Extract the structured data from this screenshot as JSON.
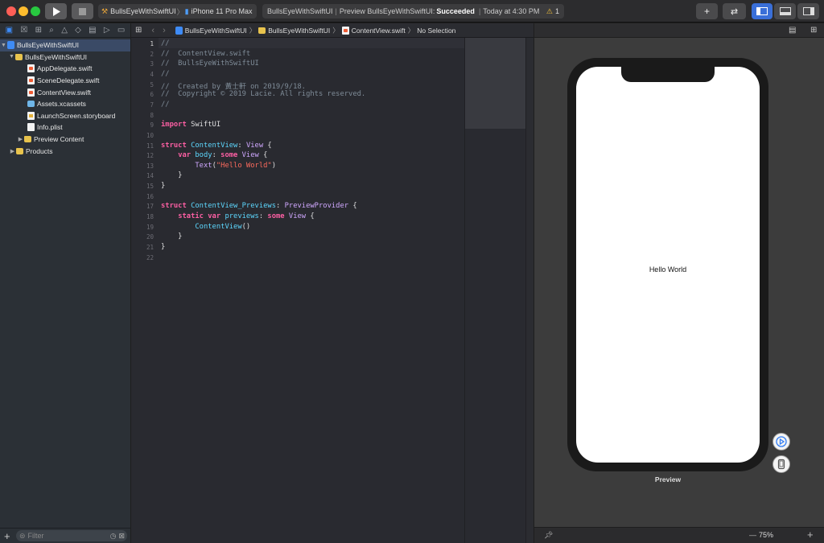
{
  "toolbar": {
    "run_icon": "play-icon",
    "stop_icon": "stop-icon",
    "scheme_target": "BullsEyeWithSwiftUI",
    "separator": "〉",
    "device": "iPhone 11 Pro Max",
    "status_project": "BullsEyeWithSwiftUI",
    "status_pipe": "|",
    "status_action": "Preview BullsEyeWithSwiftUI:",
    "status_result": "Succeeded",
    "status_pipe2": "|",
    "status_time": "Today at 4:30 PM",
    "warning_count": "1",
    "library_label": "+",
    "colors": {
      "close": "#ff5f57",
      "minimize": "#febc2e",
      "zoom": "#28c840",
      "toolbar_bg": "#2c2c2e",
      "accent": "#3d8bf7"
    }
  },
  "navigator": {
    "tabs": [
      "folder-icon",
      "source-control-icon",
      "symbol-icon",
      "find-icon",
      "issue-icon",
      "test-icon",
      "debug-icon",
      "breakpoint-icon",
      "report-icon"
    ],
    "tree": [
      {
        "label": "BullsEyeWithSwiftUI",
        "kind": "project",
        "expanded": true,
        "selected": true
      },
      {
        "label": "BullsEyeWithSwiftUI",
        "kind": "folder",
        "expanded": true
      },
      {
        "label": "AppDelegate.swift",
        "kind": "swift"
      },
      {
        "label": "SceneDelegate.swift",
        "kind": "swift"
      },
      {
        "label": "ContentView.swift",
        "kind": "swift"
      },
      {
        "label": "Assets.xcassets",
        "kind": "assets"
      },
      {
        "label": "LaunchScreen.storyboard",
        "kind": "storyboard"
      },
      {
        "label": "Info.plist",
        "kind": "plist"
      },
      {
        "label": "Preview Content",
        "kind": "folder",
        "expanded": false
      },
      {
        "label": "Products",
        "kind": "folder",
        "expanded": false
      }
    ],
    "add_label": "+",
    "filter_placeholder": "Filter"
  },
  "editor": {
    "breadcrumb": [
      "BullsEyeWithSwiftUI",
      "BullsEyeWithSwiftUI",
      "ContentView.swift",
      "No Selection"
    ],
    "code_lines": [
      [
        [
          "cmt",
          "//"
        ]
      ],
      [
        [
          "cmt",
          "//  ContentView.swift"
        ]
      ],
      [
        [
          "cmt",
          "//  BullsEyeWithSwiftUI"
        ]
      ],
      [
        [
          "cmt",
          "//"
        ]
      ],
      [
        [
          "cmt",
          "//  Created by 黃士軒 on 2019/9/18."
        ]
      ],
      [
        [
          "cmt",
          "//  Copyright © 2019 Lacie. All rights reserved."
        ]
      ],
      [
        [
          "cmt",
          "//"
        ]
      ],
      [],
      [
        [
          "kw",
          "import"
        ],
        [
          "pl",
          " SwiftUI"
        ]
      ],
      [],
      [
        [
          "kw",
          "struct"
        ],
        [
          "pl",
          " "
        ],
        [
          "ty",
          "ContentView"
        ],
        [
          "pl",
          ": "
        ],
        [
          "tf",
          "View"
        ],
        [
          "pl",
          " {"
        ]
      ],
      [
        [
          "pl",
          "    "
        ],
        [
          "kw",
          "var"
        ],
        [
          "pl",
          " "
        ],
        [
          "ty",
          "body"
        ],
        [
          "pl",
          ": "
        ],
        [
          "kw",
          "some"
        ],
        [
          "pl",
          " "
        ],
        [
          "tf",
          "View"
        ],
        [
          "pl",
          " {"
        ]
      ],
      [
        [
          "pl",
          "        "
        ],
        [
          "tf",
          "Text"
        ],
        [
          "pl",
          "("
        ],
        [
          "str",
          "\"Hello World\""
        ],
        [
          "pl",
          ")"
        ]
      ],
      [
        [
          "pl",
          "    }"
        ]
      ],
      [
        [
          "pl",
          "}"
        ]
      ],
      [],
      [
        [
          "kw",
          "struct"
        ],
        [
          "pl",
          " "
        ],
        [
          "ty",
          "ContentView_Previews"
        ],
        [
          "pl",
          ": "
        ],
        [
          "tf",
          "PreviewProvider"
        ],
        [
          "pl",
          " {"
        ]
      ],
      [
        [
          "pl",
          "    "
        ],
        [
          "kw",
          "static"
        ],
        [
          "pl",
          " "
        ],
        [
          "kw",
          "var"
        ],
        [
          "pl",
          " "
        ],
        [
          "ty",
          "previews"
        ],
        [
          "pl",
          ": "
        ],
        [
          "kw",
          "some"
        ],
        [
          "pl",
          " "
        ],
        [
          "tf",
          "View"
        ],
        [
          "pl",
          " {"
        ]
      ],
      [
        [
          "pl",
          "        "
        ],
        [
          "ty",
          "ContentView"
        ],
        [
          "pl",
          "()"
        ]
      ],
      [
        [
          "pl",
          "    }"
        ]
      ],
      [
        [
          "pl",
          "}"
        ]
      ],
      []
    ]
  },
  "canvas": {
    "preview_text": "Hello World",
    "preview_label": "Preview",
    "zoom": "75%",
    "zoom_dash": "—",
    "add_label": "+"
  }
}
